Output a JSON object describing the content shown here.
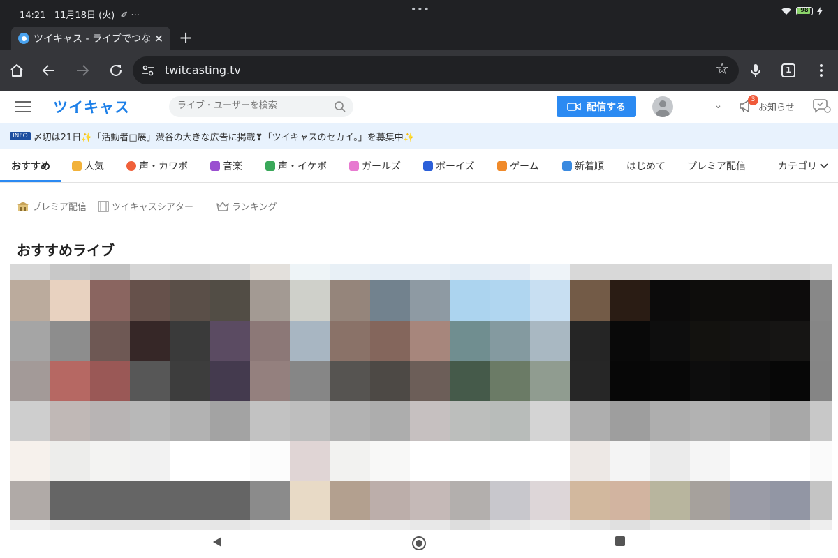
{
  "status": {
    "time": "14:21",
    "date": "11月18日 (火)",
    "extra": "✐ ···",
    "dots": "•••",
    "battery": "98"
  },
  "browser": {
    "tab_title": "ツイキャス - ライブでつな",
    "new_tab": "+",
    "url": "twitcasting.tv",
    "tab_count": "1"
  },
  "site": {
    "logo": "ツイキャス",
    "search_placeholder": "ライブ・ユーザーを検索",
    "broadcast_label": "配信する",
    "notifications_label": "お知らせ",
    "notification_count": "3"
  },
  "announcement": {
    "tag": "INFO",
    "text": "〆切は21日✨「活動者□展」渋谷の大きな広告に掲載❣「ツイキャスのセカイ。」を募集中✨"
  },
  "categories": [
    {
      "label": "おすすめ",
      "color": ""
    },
    {
      "label": "人気",
      "color": "#f2b23a"
    },
    {
      "label": "声・カワボ",
      "color": "#f0603a"
    },
    {
      "label": "音楽",
      "color": "#9a4fd0"
    },
    {
      "label": "声・イケボ",
      "color": "#3aa85a"
    },
    {
      "label": "ガールズ",
      "color": "#e77ad0"
    },
    {
      "label": "ボーイズ",
      "color": "#2b5fd9"
    },
    {
      "label": "ゲーム",
      "color": "#f08a2a"
    },
    {
      "label": "新着順",
      "color": "#3a8ae0"
    },
    {
      "label": "はじめて",
      "color": ""
    },
    {
      "label": "プレミア配信",
      "color": ""
    },
    {
      "label": "カテゴリ",
      "color": ""
    }
  ],
  "sublinks": {
    "premier": "プレミア配信",
    "theater": "ツイキャスシアター",
    "ranking": "ランキング"
  },
  "section_title": "おすすめライブ",
  "mosaic_colors": [
    [
      "#d8d8d8",
      "#c8c8c8",
      "#c2c2c2",
      "#d5d5d5",
      "#d2d2d2",
      "#d5d5d5",
      "#e3e0dc",
      "#eef4f7",
      "#e8f0f6",
      "#e6eef6",
      "#e6eef6",
      "#e2ecf5",
      "#e4ecf5",
      "#eef3f8",
      "#d8d8d8",
      "#d8d8d8",
      "#dadada",
      "#dadada",
      "#d8d8d8",
      "#d5d5d5",
      "#dadada"
    ],
    [
      "#bbab9d",
      "#e8d2c0",
      "#8a6560",
      "#66514b",
      "#5a4f48",
      "#524d45",
      "#a39a93",
      "#cfd0ca",
      "#95857b",
      "#72828e",
      "#8e9aa3",
      "#acd4ef",
      "#b0d6f0",
      "#c8dff2",
      "#735b47",
      "#2a1c14",
      "#0c0b0b",
      "#0e0d0c",
      "#0e0d0c",
      "#0d0c0c",
      "#888888"
    ],
    [
      "#a5a5a5",
      "#8d8d8d",
      "#6e5854",
      "#362727",
      "#3a3a3a",
      "#5b4b62",
      "#8c7877",
      "#a8b6c2",
      "#8a7268",
      "#84665c",
      "#a7867c",
      "#708e90",
      "#849aa0",
      "#a9b8c2",
      "#252525",
      "#090909",
      "#0e0e0e",
      "#13120f",
      "#141312",
      "#161514",
      "#868686"
    ],
    [
      "#a39a98",
      "#b66863",
      "#9a5856",
      "#575757",
      "#3d3d3d",
      "#443a4e",
      "#94807e",
      "#868686",
      "#565451",
      "#4d4945",
      "#6c5e58",
      "#455a4a",
      "#6b7b66",
      "#909c90",
      "#262626",
      "#070707",
      "#080808",
      "#0d0d0d",
      "#0b0b0b",
      "#070707",
      "#858585"
    ],
    [
      "#cecece",
      "#c0b8b6",
      "#b8b4b4",
      "#b8b8b8",
      "#b2b2b2",
      "#a3a3a3",
      "#c2c2c2",
      "#bebebe",
      "#b2b2b2",
      "#adadad",
      "#c6c0c0",
      "#bcbebc",
      "#b8bcba",
      "#d4d4d4",
      "#aeaeae",
      "#9e9e9e",
      "#aeaeae",
      "#b2b2b2",
      "#b0b0b0",
      "#a8a8a8",
      "#c8c8c8"
    ],
    [
      "#f6f1ec",
      "#ededeb",
      "#f3f3f2",
      "#f2f2f2",
      "#ffffff",
      "#ffffff",
      "#fcfcfc",
      "#e0d5d5",
      "#f2f2f0",
      "#f8f8f7",
      "#ffffff",
      "#ffffff",
      "#ffffff",
      "#ffffff",
      "#ede8e5",
      "#f4f4f4",
      "#ebebeb",
      "#f5f5f5",
      "#ffffff",
      "#ffffff",
      "#fafafa"
    ],
    [
      "#b0aaa7",
      "#656565",
      "#656565",
      "#656565",
      "#656565",
      "#656565",
      "#8b8b8b",
      "#e8dac6",
      "#b3a08f",
      "#bcaeaa",
      "#c5b9b7",
      "#b3afad",
      "#c8c7cc",
      "#ddd6d8",
      "#d2b89e",
      "#d2b4a0",
      "#b8b59e",
      "#a6a19c",
      "#9a9ba6",
      "#9296a4",
      "#c4c4c4"
    ],
    [
      "#efefef",
      "#e8e8e8",
      "#e5e5e5",
      "#e5e5e5",
      "#e8e8e8",
      "#e6e6e6",
      "#ebebeb",
      "#ededed",
      "#eeeeee",
      "#ececec",
      "#e8e8e8",
      "#dddddd",
      "#e6e6e6",
      "#ebebeb",
      "#e6e6e6",
      "#e0e0e0",
      "#e9e9e9",
      "#eaeaea",
      "#ebebeb",
      "#e6e6e6",
      "#eeeeee"
    ]
  ]
}
